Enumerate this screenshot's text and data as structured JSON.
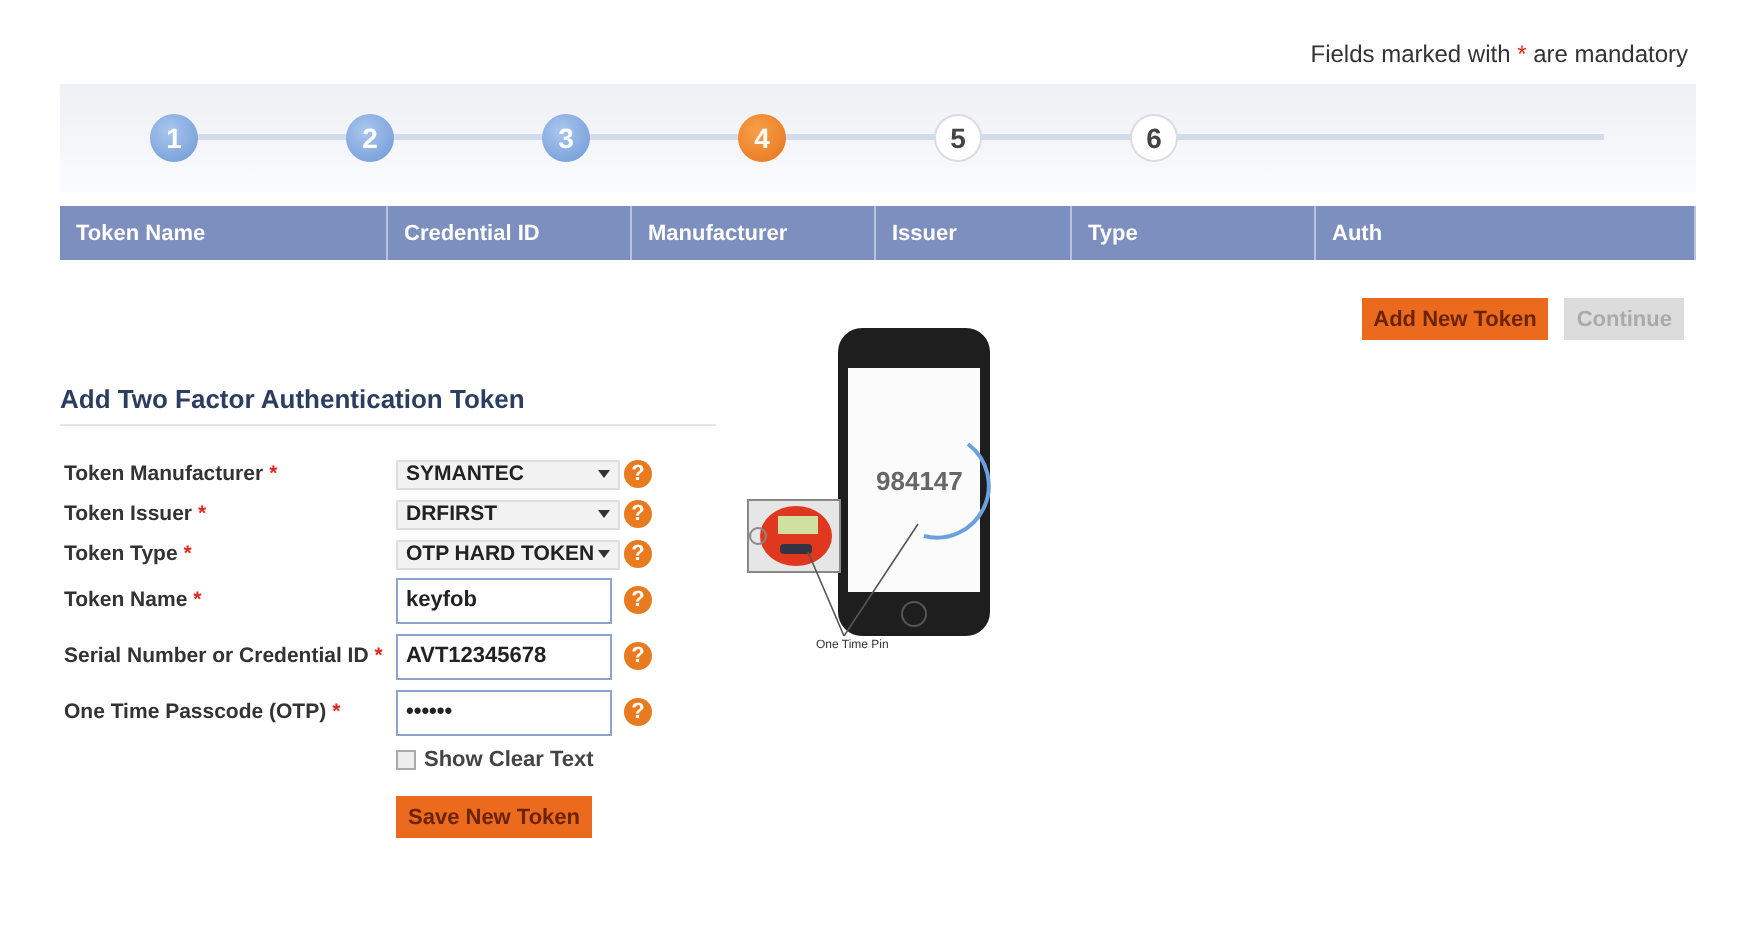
{
  "mandatory_note": {
    "before": "Fields marked with",
    "mark": "*",
    "after": "are mandatory"
  },
  "steps": [
    {
      "number": "1",
      "completed": true,
      "selected": false
    },
    {
      "number": "2",
      "completed": true,
      "selected": false
    },
    {
      "number": "3",
      "completed": true,
      "selected": false
    },
    {
      "number": "4",
      "completed": false,
      "selected": true
    },
    {
      "number": "5",
      "completed": false,
      "selected": false
    },
    {
      "number": "6",
      "completed": false,
      "selected": false
    }
  ],
  "table": {
    "columns": [
      "Token Name",
      "Credential ID",
      "Manufacturer",
      "Issuer",
      "Type",
      "Auth"
    ]
  },
  "actions": [
    {
      "label": "Add New Token",
      "disabled": false
    },
    {
      "label": "Continue",
      "disabled": true
    }
  ],
  "form": {
    "title": "Add Two Factor Authentication Token",
    "required_mark": "*",
    "fields": [
      {
        "kind": "select",
        "label": "Token Manufacturer",
        "value": "SYMANTEC",
        "required": true,
        "help": "?"
      },
      {
        "kind": "select",
        "label": "Token Issuer",
        "value": "DRFIRST",
        "required": true,
        "help": "?"
      },
      {
        "kind": "select",
        "label": "Token Type",
        "value": "OTP HARD TOKEN",
        "required": true,
        "help": "?"
      },
      {
        "kind": "input",
        "label": "Token Name",
        "value": "keyfob",
        "required": true,
        "help": "?"
      },
      {
        "kind": "input",
        "label": "Serial Number or Credential ID",
        "value": "AVT12345678",
        "required": true,
        "help": "?"
      },
      {
        "kind": "password",
        "label": "One Time Passcode (OTP)",
        "value": "••••••",
        "required": true,
        "help": "?"
      }
    ],
    "show_clear_text": {
      "label": "Show Clear Text",
      "checked": false
    },
    "submit": "Save New Token"
  },
  "illustration": {
    "code": "984147",
    "caption": "One Time Pin"
  }
}
